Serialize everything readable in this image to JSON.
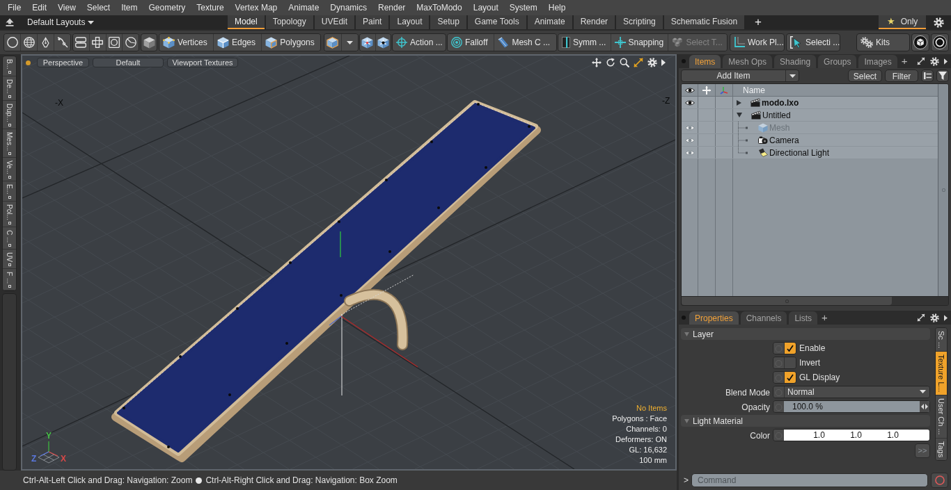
{
  "menu_bar": {
    "items": [
      "File",
      "Edit",
      "View",
      "Select",
      "Item",
      "Geometry",
      "Texture",
      "Vertex Map",
      "Animate",
      "Dynamics",
      "Render",
      "MaxToModo",
      "Layout",
      "System",
      "Help"
    ]
  },
  "layout_bar": {
    "layout_menu": "Default Layouts",
    "tabs": [
      {
        "label": "Model",
        "selected": true
      },
      {
        "label": "Topology",
        "selected": false
      },
      {
        "label": "UVEdit",
        "selected": false
      },
      {
        "label": "Paint",
        "selected": false
      },
      {
        "label": "Layout",
        "selected": false
      },
      {
        "label": "Setup",
        "selected": false
      },
      {
        "label": "Game Tools",
        "selected": false
      },
      {
        "label": "Animate",
        "selected": false
      },
      {
        "label": "Render",
        "selected": false
      },
      {
        "label": "Scripting",
        "selected": false
      },
      {
        "label": "Schematic Fusion",
        "selected": false
      }
    ],
    "add_tab": "+",
    "favorites_filter": {
      "star": "★",
      "label": "Only",
      "on": true
    }
  },
  "toolbar": {
    "tools": [
      {
        "label": "Vertices",
        "disabled": false
      },
      {
        "label": "Edges",
        "disabled": false
      },
      {
        "label": "Polygons",
        "disabled": false
      },
      {
        "label": "Action ...",
        "disabled": false
      },
      {
        "label": "Falloff",
        "disabled": false
      },
      {
        "label": "Mesh C ...",
        "disabled": false
      },
      {
        "label": "Symm ...",
        "disabled": false
      },
      {
        "label": "Snapping",
        "disabled": false
      },
      {
        "label": "Select T...",
        "disabled": true
      },
      {
        "label": "Work Pl...",
        "disabled": false
      },
      {
        "label": "Selecti ...",
        "disabled": false
      },
      {
        "label": "Kits",
        "disabled": false
      }
    ]
  },
  "left_tabs": [
    "B...",
    "De...",
    "Dup...",
    "Mes...",
    "Ve...",
    "E...",
    "Pol...",
    "C ...",
    "UV",
    "F ..."
  ],
  "viewport": {
    "header_buttons": [
      "Perspective",
      "Default",
      "Viewport Textures"
    ],
    "corner_labels": [
      "-X",
      "-Z"
    ],
    "gizmo_labels": [
      {
        "text": "Y",
        "color": "#46c046"
      },
      {
        "text": "Z",
        "color": "#5a78e0"
      },
      {
        "text": "X",
        "color": "#d84848"
      }
    ],
    "info": [
      {
        "text": "No Items",
        "highlight": true
      },
      {
        "text": "Polygons : Face",
        "highlight": false
      },
      {
        "text": "Channels: 0",
        "highlight": false
      },
      {
        "text": "Deformers: ON",
        "highlight": false
      },
      {
        "text": "GL: 16,632",
        "highlight": false
      },
      {
        "text": "100 mm",
        "highlight": false
      }
    ]
  },
  "items_panel": {
    "tabs": [
      {
        "label": "Items",
        "selected": true
      },
      {
        "label": "Mesh Ops",
        "selected": false
      },
      {
        "label": "Shading",
        "selected": false
      },
      {
        "label": "Groups",
        "selected": false
      },
      {
        "label": "Images",
        "selected": false
      }
    ],
    "add_tab": "+",
    "add_item": "Add Item",
    "buttons": [
      "Select",
      "Filter"
    ],
    "name_column": "Name",
    "tree": [
      {
        "name": "modo.lxo",
        "kind": "scene",
        "current": true,
        "expanded": false,
        "visible": true
      },
      {
        "name": "Untitled",
        "kind": "scene",
        "current": false,
        "expanded": true,
        "visible": false,
        "children": [
          {
            "name": "Mesh",
            "kind": "mesh",
            "dimmed": true,
            "visible": true
          },
          {
            "name": "Camera",
            "kind": "camera",
            "dimmed": false,
            "visible": true
          },
          {
            "name": "Directional Light",
            "kind": "light",
            "dimmed": false,
            "visible": true
          }
        ]
      }
    ]
  },
  "properties_panel": {
    "tabs": [
      {
        "label": "Properties",
        "selected": true
      },
      {
        "label": "Channels",
        "selected": false
      },
      {
        "label": "Lists",
        "selected": false
      }
    ],
    "add_tab": "+",
    "sections": [
      {
        "title": "Layer",
        "expanded": true,
        "rows": [
          {
            "kind": "checkbox",
            "label": "Enable",
            "checked": true
          },
          {
            "kind": "checkbox",
            "label": "Invert",
            "checked": false
          },
          {
            "kind": "checkbox",
            "label": "GL Display",
            "checked": true
          },
          {
            "kind": "dropdown",
            "label": "Blend Mode",
            "value": "Normal"
          },
          {
            "kind": "number",
            "label": "Opacity",
            "value": "100.0 %"
          }
        ]
      },
      {
        "title": "Light Material",
        "expanded": true,
        "rows": [
          {
            "kind": "color",
            "label": "Color",
            "values": [
              "1.0",
              "1.0",
              "1.0"
            ]
          }
        ]
      }
    ],
    "more_button": ">>",
    "side_tabs": [
      {
        "label": "Sc ...",
        "selected": false
      },
      {
        "label": "Texture L...",
        "selected": true
      },
      {
        "label": "User Ch ...",
        "selected": false
      },
      {
        "label": "Tags",
        "selected": false
      }
    ]
  },
  "command_bar": {
    "prompt": ">",
    "placeholder": "Command"
  },
  "status_bar": {
    "hints": [
      "Ctrl-Alt-Left Click and Drag: Navigation: Zoom",
      "Ctrl-Alt-Right Click and Drag: Navigation: Box Zoom"
    ]
  }
}
